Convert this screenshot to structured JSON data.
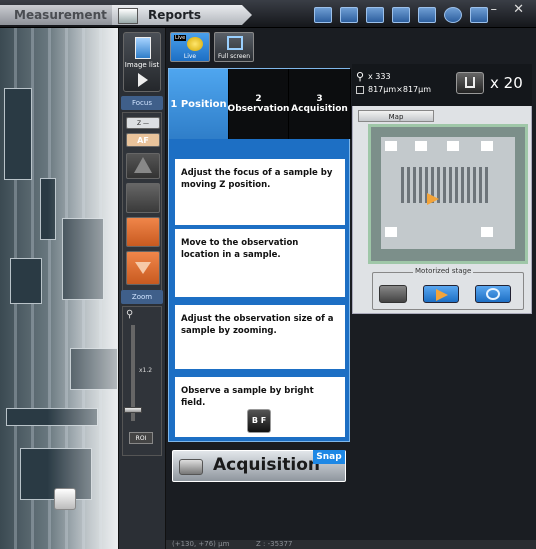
{
  "tabs": {
    "measurement": "Measurement",
    "reports": "Reports"
  },
  "toolbar_icons": [
    "folder-icon",
    "open-icon",
    "save-icon",
    "print-icon",
    "tools-icon",
    "help-icon",
    "settings-icon"
  ],
  "window_controls": "– ✕",
  "image_list": {
    "label": "Image list"
  },
  "focus": {
    "header": "Focus",
    "z_label": "Z —",
    "af_label": "AF"
  },
  "zoom": {
    "header": "Zoom",
    "value": "x1.2",
    "roi_label": "ROI"
  },
  "live": {
    "live_label": "Live",
    "fullscreen_label": "Full screen",
    "live_badge": "Live"
  },
  "steps": {
    "tabs": [
      "1 Position",
      "2 Observation",
      "3 Acquisition"
    ],
    "cards": [
      "Adjust the focus of a sample by moving Z position.",
      "Move to the observation location in a sample.",
      "Adjust the observation size of a sample by zooming.",
      "Observe a sample by bright field."
    ],
    "bf_label": "B F"
  },
  "acquisition": {
    "label": "Acquisition",
    "snap_label": "Snap"
  },
  "map": {
    "zoom_readout": "x 333",
    "field_size": "817µm×817µm",
    "magnification": "x 20",
    "map_tab": "Map",
    "motorized_stage": "Motorized stage"
  },
  "status": {
    "position": "(+130, +76) µm",
    "z": "Z : -35377"
  },
  "colors": {
    "accent": "#1d6fc4",
    "active_tab": "#4fa6ef",
    "snap": "#1e88e5"
  }
}
